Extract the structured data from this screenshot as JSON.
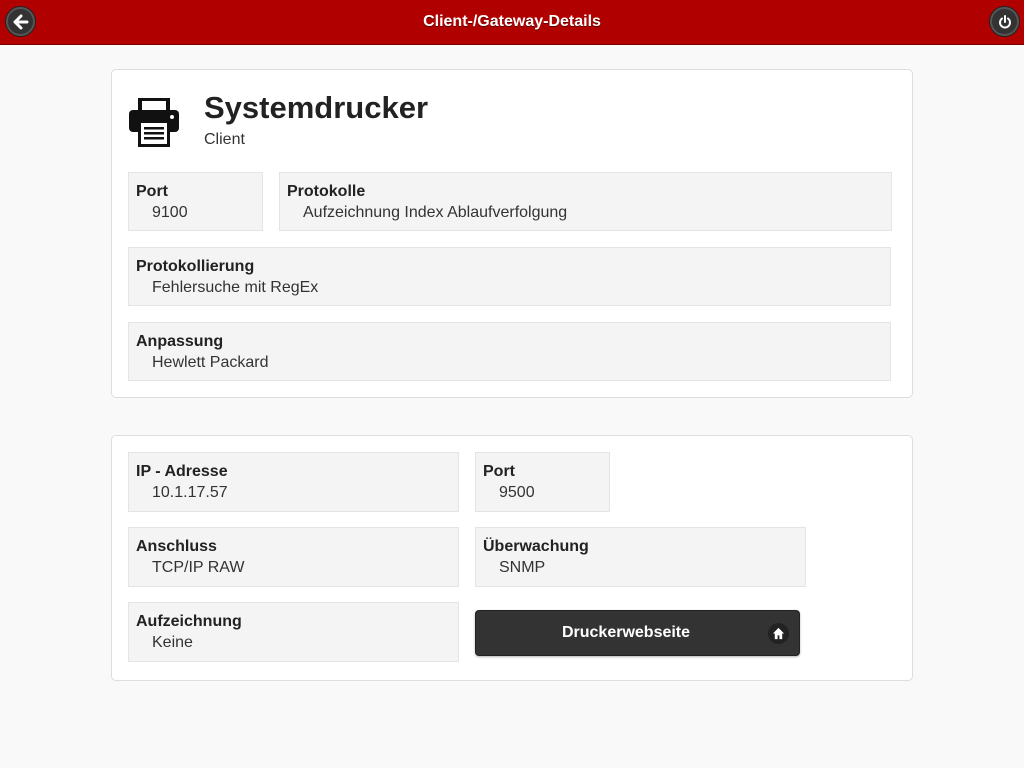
{
  "header": {
    "title": "Client-/Gateway-Details"
  },
  "device": {
    "name": "Systemdrucker",
    "type": "Client",
    "icon": "printer-icon"
  },
  "client_fields": {
    "port": {
      "label": "Port",
      "value": "9100"
    },
    "protocols": {
      "label": "Protokolle",
      "value": "Aufzeichnung Index Ablaufverfolgung"
    },
    "logging": {
      "label": "Protokollierung",
      "value": "Fehlersuche mit RegEx"
    },
    "customization": {
      "label": "Anpassung",
      "value": "Hewlett Packard"
    }
  },
  "printer_fields": {
    "ip": {
      "label": "IP - Adresse",
      "value": "10.1.17.57"
    },
    "port": {
      "label": "Port",
      "value": "9500"
    },
    "connection": {
      "label": "Anschluss",
      "value": "TCP/IP RAW"
    },
    "monitoring": {
      "label": "Überwachung",
      "value": "SNMP"
    },
    "recording": {
      "label": "Aufzeichnung",
      "value": "Keine"
    }
  },
  "web_button": {
    "label": "Druckerwebseite",
    "icon": "home-icon"
  },
  "colors": {
    "header": "#b00000",
    "button": "#333333",
    "field_bg": "#f4f4f4"
  }
}
